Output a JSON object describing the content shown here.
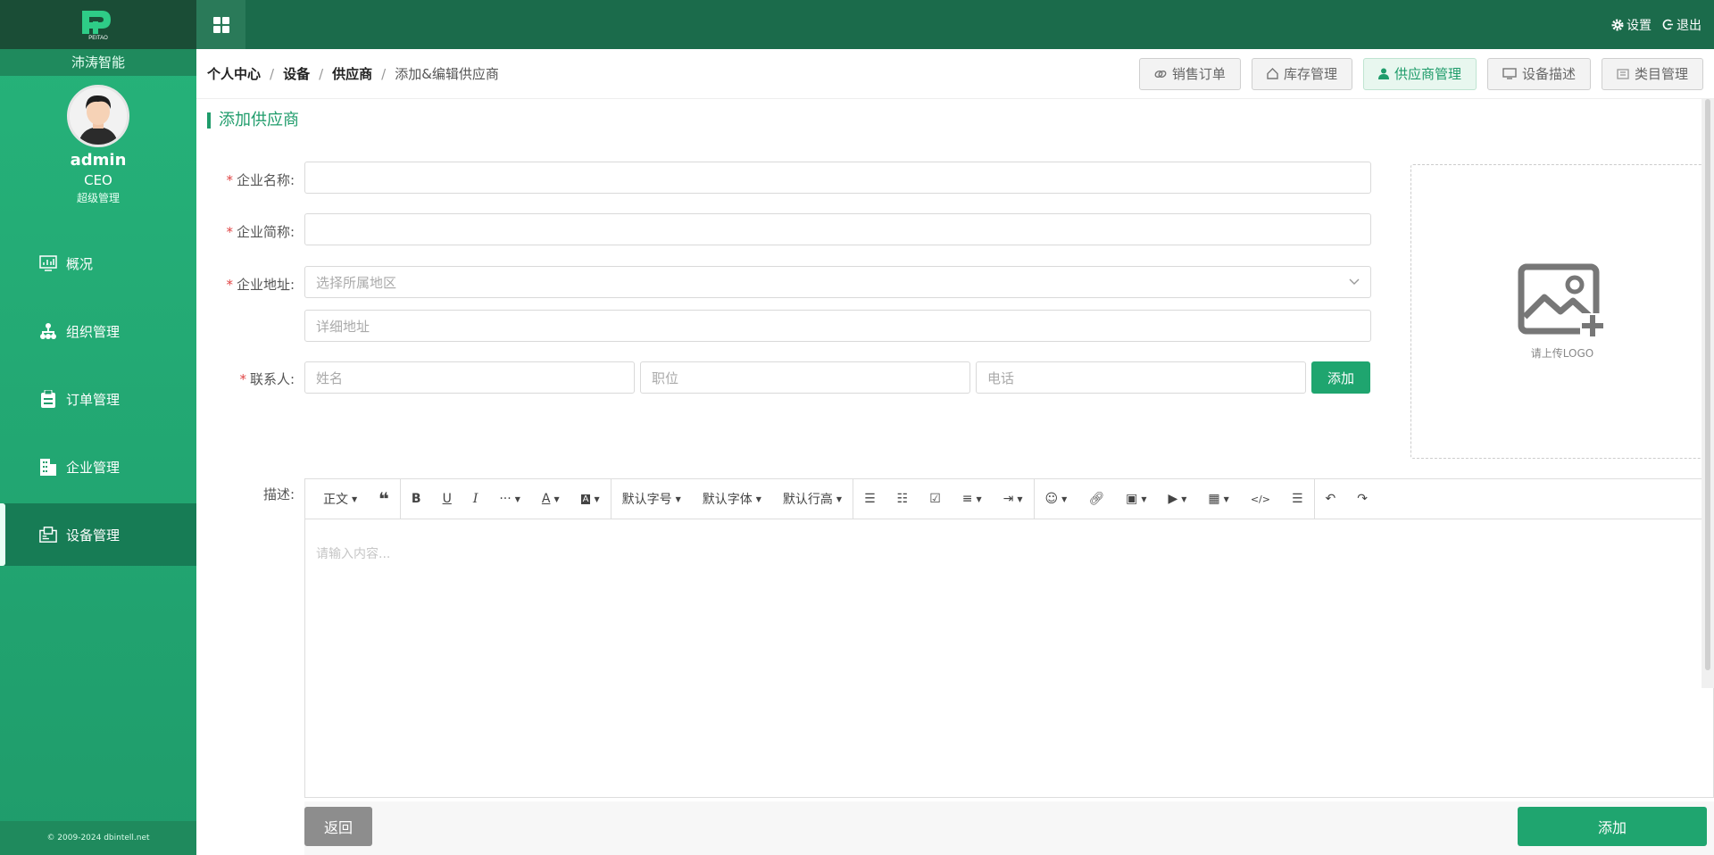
{
  "brand": {
    "logo_text": "PEITAO",
    "name": "沛涛智能"
  },
  "user": {
    "name": "admin",
    "role": "CEO",
    "tag": "超级管理"
  },
  "sidebar": {
    "items": [
      {
        "label": "概况",
        "icon": "chart-icon"
      },
      {
        "label": "组织管理",
        "icon": "org-icon"
      },
      {
        "label": "订单管理",
        "icon": "clipboard-icon"
      },
      {
        "label": "企业管理",
        "icon": "building-icon"
      },
      {
        "label": "设备管理",
        "icon": "device-icon",
        "active": true
      }
    ]
  },
  "copyright": "© 2009-2024 dbintell.net",
  "topbar": {
    "settings": "设置",
    "logout": "退出"
  },
  "breadcrumb": [
    "个人中心",
    "设备",
    "供应商",
    "添加&编辑供应商"
  ],
  "tabs": [
    {
      "label": "销售订单",
      "icon": "link-icon"
    },
    {
      "label": "库存管理",
      "icon": "home-icon"
    },
    {
      "label": "供应商管理",
      "icon": "user-icon",
      "active": true
    },
    {
      "label": "设备描述",
      "icon": "monitor-icon"
    },
    {
      "label": "类目管理",
      "icon": "list-icon"
    }
  ],
  "form": {
    "title": "添加供应商",
    "company_name_label": "企业名称:",
    "short_name_label": "企业简称:",
    "address_label": "企业地址:",
    "region_placeholder": "选择所属地区",
    "detail_placeholder": "详细地址",
    "contact_label": "联系人:",
    "contact_name_placeholder": "姓名",
    "contact_position_placeholder": "职位",
    "contact_phone_placeholder": "电话",
    "add_contact_label": "添加",
    "upload_hint": "请上传LOGO",
    "desc_label": "描述:",
    "editor_placeholder": "请输入内容...",
    "back_label": "返回",
    "submit_label": "添加"
  },
  "toolbar": {
    "heading": "正文",
    "font_size": "默认字号",
    "font_family": "默认字体",
    "line_height": "默认行高",
    "more": "···"
  },
  "colors": {
    "primary": "#1fa56f",
    "sidebar_top": "#1a4d36",
    "topbar": "#1b6b4b"
  }
}
